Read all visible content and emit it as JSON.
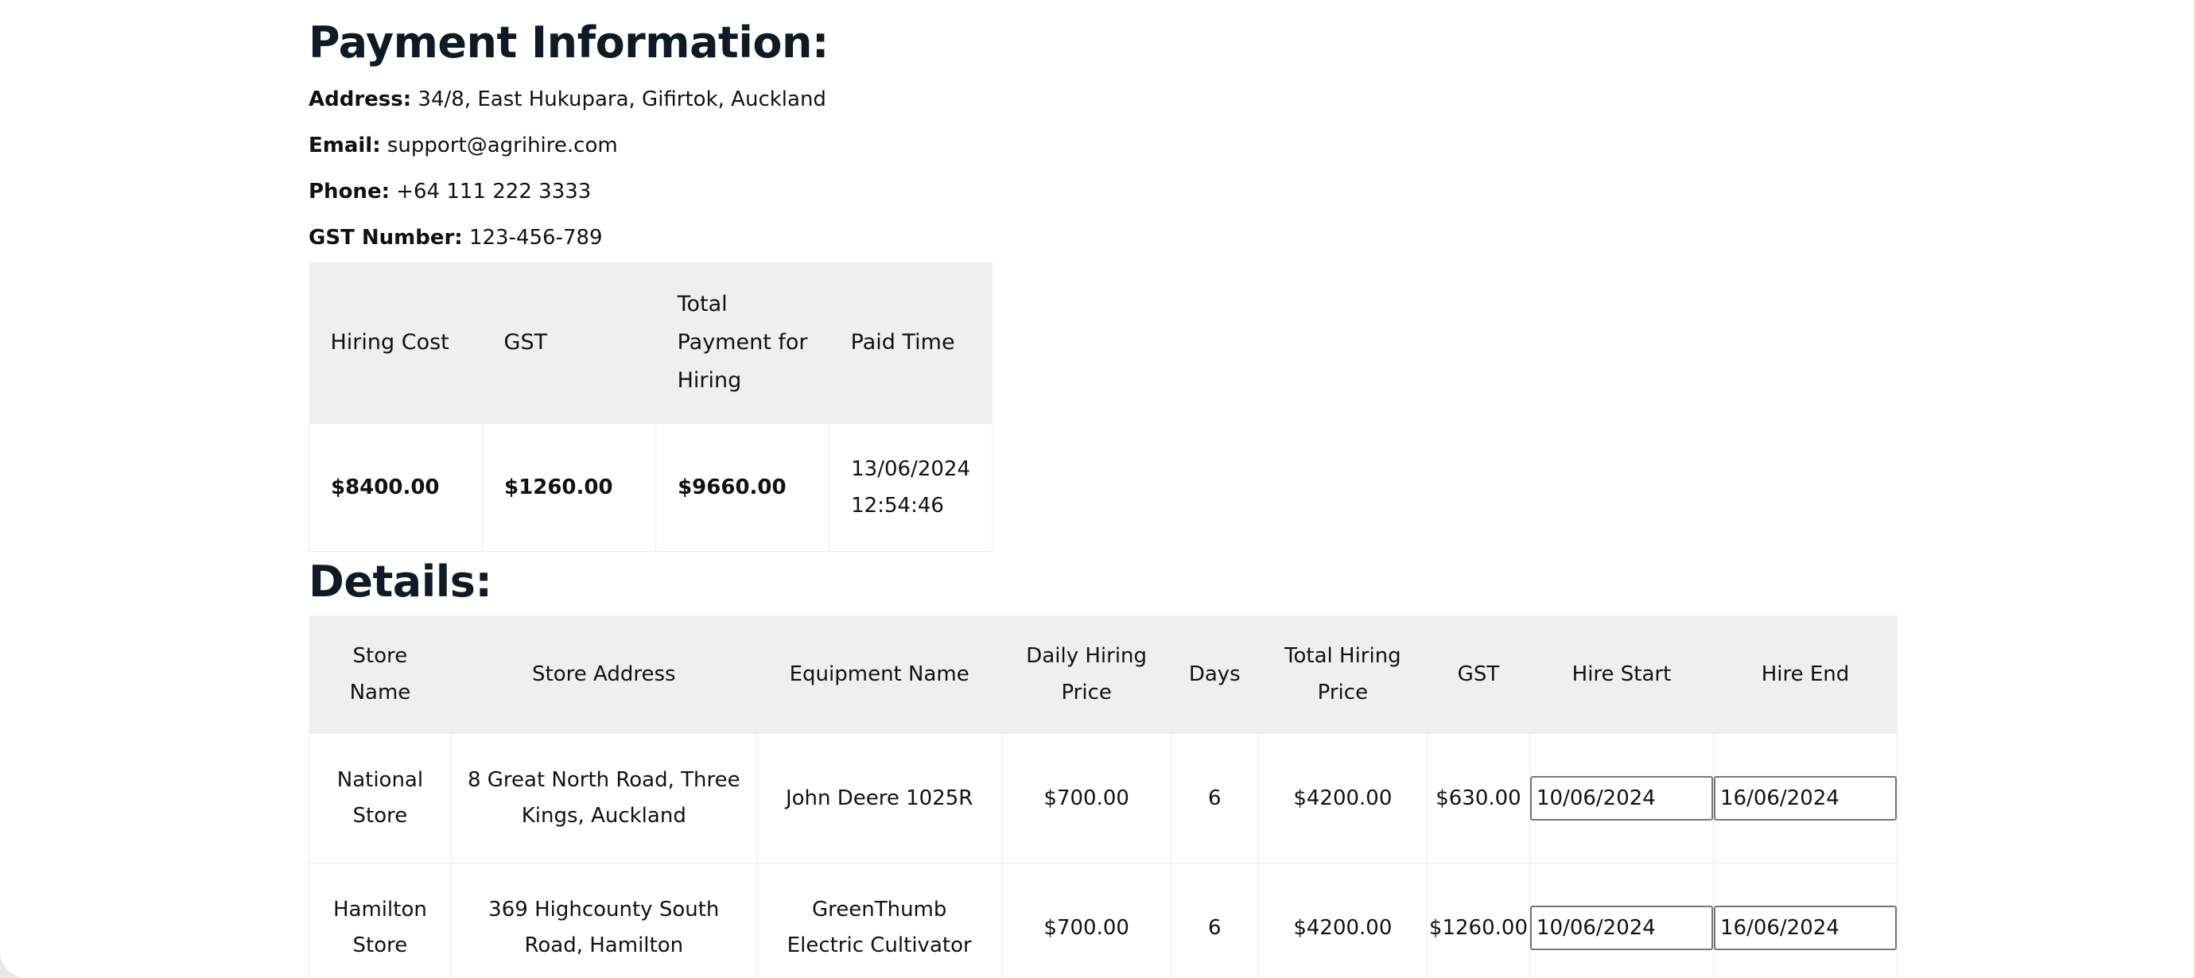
{
  "payment": {
    "title": "Payment Information:",
    "address_label": "Address:",
    "address_value": "34/8, East Hukupara, Gifirtok, Auckland",
    "email_label": "Email:",
    "email_value": "support@agrihire.com",
    "phone_label": "Phone:",
    "phone_value": "+64 111 222 3333",
    "gst_label": "GST Number:",
    "gst_value": "123-456-789",
    "table": {
      "headers": [
        "Hiring Cost",
        "GST",
        "Total Payment for Hiring",
        "Paid Time"
      ],
      "row": {
        "hiring_cost": "$8400.00",
        "gst": "$1260.00",
        "total": "$9660.00",
        "paid_date": "13/06/2024",
        "paid_time": "12:54:46"
      }
    }
  },
  "details": {
    "title": "Details:",
    "headers": [
      "Store Name",
      "Store Address",
      "Equipment Name",
      "Daily Hiring Price",
      "Days",
      "Total Hiring Price",
      "GST",
      "Hire Start",
      "Hire End"
    ],
    "rows": [
      {
        "store_name": "National Store",
        "store_address": "8 Great North Road, Three Kings, Auckland",
        "equipment": "John Deere 1025R",
        "daily_price": "$700.00",
        "days": "6",
        "total_price": "$4200.00",
        "gst": "$630.00",
        "hire_start": "10/06/2024",
        "hire_end": "16/06/2024"
      },
      {
        "store_name": "Hamilton Store",
        "store_address": "369 Highcounty South Road, Hamilton",
        "equipment": "GreenThumb Electric Cultivator",
        "daily_price": "$700.00",
        "days": "6",
        "total_price": "$4200.00",
        "gst": "$1260.00",
        "hire_start": "10/06/2024",
        "hire_end": "16/06/2024"
      }
    ]
  }
}
